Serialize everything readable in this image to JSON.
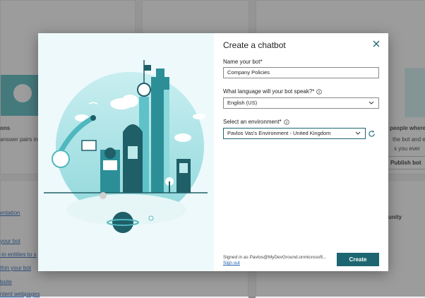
{
  "background": {
    "card1": {
      "heading": "ons",
      "desc": "answer pairs in y"
    },
    "card3": {
      "heading": "people where th",
      "desc1": "the bot and e",
      "desc2": "s you ever",
      "button": "Publish bot"
    },
    "community": "unity",
    "links": [
      "entation",
      "your bot",
      "-in entities to s",
      "thin your bot",
      "bsite",
      "ntent webpages"
    ]
  },
  "dialog": {
    "title": "Create a chatbot",
    "name_label": "Name your bot*",
    "name_value": "Company Policies",
    "language_label": "What language will your bot speak?*",
    "language_value": "English (US)",
    "environment_label": "Select an environment*",
    "environment_value": "Pavlos Vas's Environment - United Kingdom",
    "signed_in": "Signed in as Pavlos@MyDevGround.onmicrosoft...",
    "sign_out": "Sign out",
    "create_button": "Create",
    "colors": {
      "accent": "#1d6671",
      "teal_light": "#7fd3d6"
    }
  },
  "icons": [
    "close-icon",
    "info-icon",
    "chevron-down-icon",
    "refresh-icon"
  ]
}
